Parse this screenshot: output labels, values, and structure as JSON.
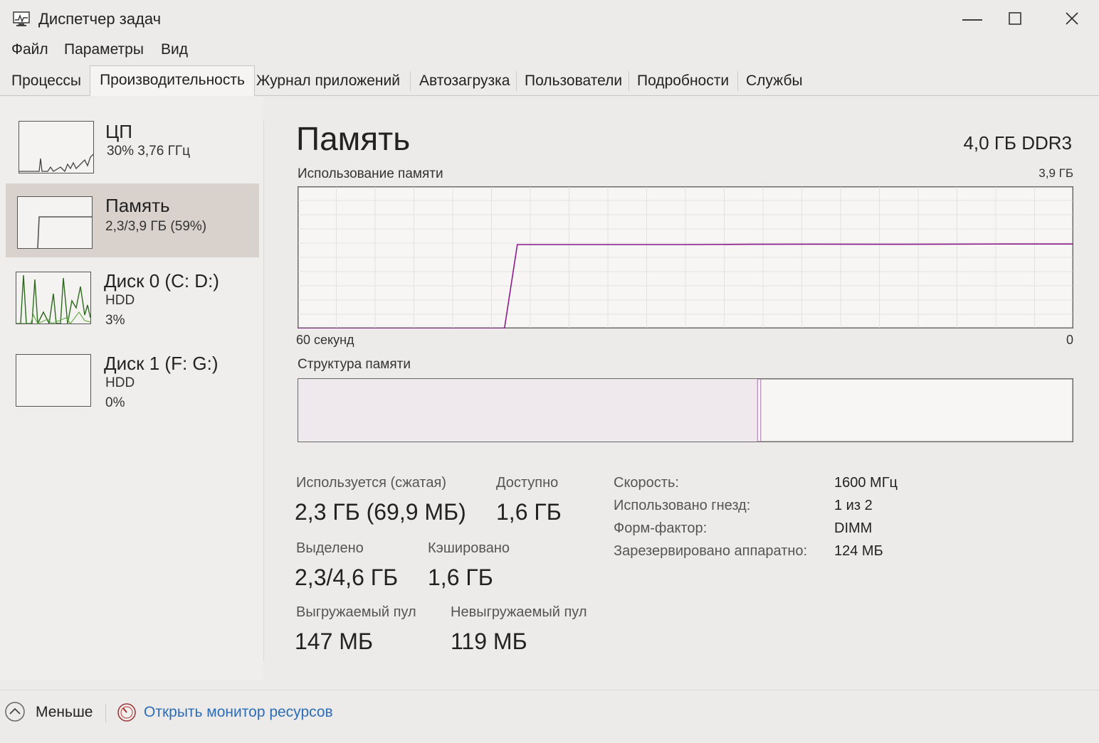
{
  "window": {
    "title": "Диспетчер задач"
  },
  "menu": [
    "Файл",
    "Параметры",
    "Вид"
  ],
  "tabs": [
    "Процессы",
    "Производительность",
    "Журнал приложений",
    "Автозагрузка",
    "Пользователи",
    "Подробности",
    "Службы"
  ],
  "active_tab": 1,
  "resources": [
    {
      "name": "ЦП",
      "sub1": "30% 3,76 ГГц",
      "sub2": ""
    },
    {
      "name": "Память",
      "sub1": "2,3/3,9 ГБ (59%)",
      "sub2": ""
    },
    {
      "name": "Диск 0 (C: D:)",
      "sub1": "HDD",
      "sub2": "3%"
    },
    {
      "name": "Диск 1 (F: G:)",
      "sub1": "HDD",
      "sub2": "0%"
    }
  ],
  "selected_resource": 1,
  "memory": {
    "title": "Память",
    "type": "4,0 ГБ DDR3",
    "usage_label": "Использование памяти",
    "usage_max": "3,9 ГБ",
    "axis_left": "60 секунд",
    "axis_right": "0",
    "structure_label": "Структура памяти",
    "usage_series": [
      [
        60,
        0
      ],
      [
        44,
        0
      ],
      [
        43,
        59
      ],
      [
        40,
        59
      ],
      [
        35,
        59
      ],
      [
        30,
        59
      ],
      [
        25,
        59.2
      ],
      [
        20,
        59.3
      ],
      [
        15,
        59.2
      ],
      [
        10,
        59.3
      ],
      [
        5,
        59.4
      ],
      [
        0,
        59.4
      ]
    ],
    "structure": {
      "in_use_fraction": 0.593,
      "modified_fraction": 0.004
    }
  },
  "stats": {
    "in_use": {
      "label": "Используется (сжатая)",
      "value": "2,3 ГБ (69,9 МБ)"
    },
    "available": {
      "label": "Доступно",
      "value": "1,6 ГБ"
    },
    "committed": {
      "label": "Выделено",
      "value": "2,3/4,6 ГБ"
    },
    "cached": {
      "label": "Кэшировано",
      "value": "1,6 ГБ"
    },
    "paged_pool": {
      "label": "Выгружаемый пул",
      "value": "147 МБ"
    },
    "nonpaged_pool": {
      "label": "Невыгружаемый пул",
      "value": "119 МБ"
    }
  },
  "specs": [
    {
      "label": "Скорость:",
      "value": "1600 МГц"
    },
    {
      "label": "Использовано гнезд:",
      "value": "1 из 2"
    },
    {
      "label": "Форм-фактор:",
      "value": "DIMM"
    },
    {
      "label": "Зарезервировано аппаратно:",
      "value": "124 МБ"
    }
  ],
  "footer": {
    "less": "Меньше",
    "monitor": "Открыть монитор ресурсов"
  },
  "colors": {
    "memory_accent": "#8b1a8b",
    "disk_accent": "#4c9a2a",
    "cpu_accent": "#1a6fb5",
    "link": "#2d6db5"
  }
}
